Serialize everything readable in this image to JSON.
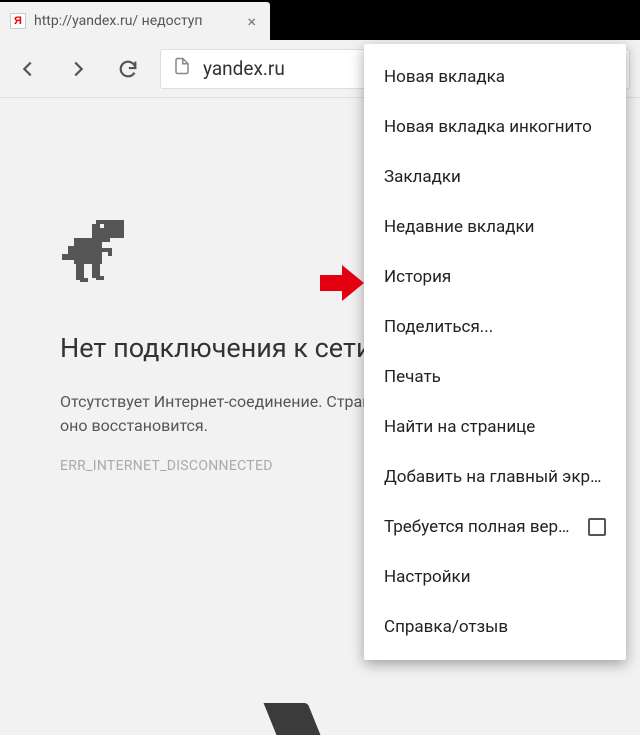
{
  "tab": {
    "title": "http://yandex.ru/ недоступ",
    "close_glyph": "×"
  },
  "toolbar": {
    "address": "yandex.ru"
  },
  "error_page": {
    "heading": "Нет подключения к сети",
    "body": "Отсутствует Интернет-соединение. Страница будет загружена, когда оно восстановится.",
    "code": "ERR_INTERNET_DISCONNECTED"
  },
  "menu": {
    "items": [
      {
        "label": "Новая вкладка"
      },
      {
        "label": "Новая вкладка инкогнито"
      },
      {
        "label": "Закладки"
      },
      {
        "label": "Недавние вкладки"
      },
      {
        "label": "История"
      },
      {
        "label": "Поделиться..."
      },
      {
        "label": "Печать"
      },
      {
        "label": "Найти на странице"
      },
      {
        "label": "Добавить на главный экран"
      },
      {
        "label": "Требуется полная верс…",
        "checkbox": true
      },
      {
        "label": "Настройки"
      },
      {
        "label": "Справка/отзыв"
      }
    ]
  }
}
